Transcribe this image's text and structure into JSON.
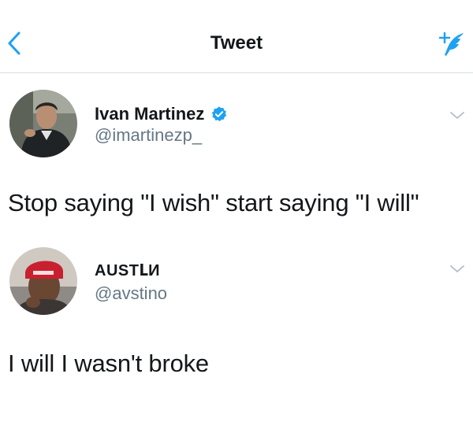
{
  "header": {
    "title": "Tweet",
    "back_icon": "chevron-left-icon",
    "compose_icon": "compose-tweet-icon",
    "accent_color": "#1da1f2"
  },
  "tweets": [
    {
      "display_name": "Ivan Martinez",
      "handle": "@imartinezp_",
      "verified": true,
      "text": "Stop saying \"I wish\" start saying \"I will\""
    },
    {
      "display_name": "AUSTԼИ",
      "handle": "@avstino",
      "verified": false,
      "text": "I will I wasn't broke"
    }
  ]
}
